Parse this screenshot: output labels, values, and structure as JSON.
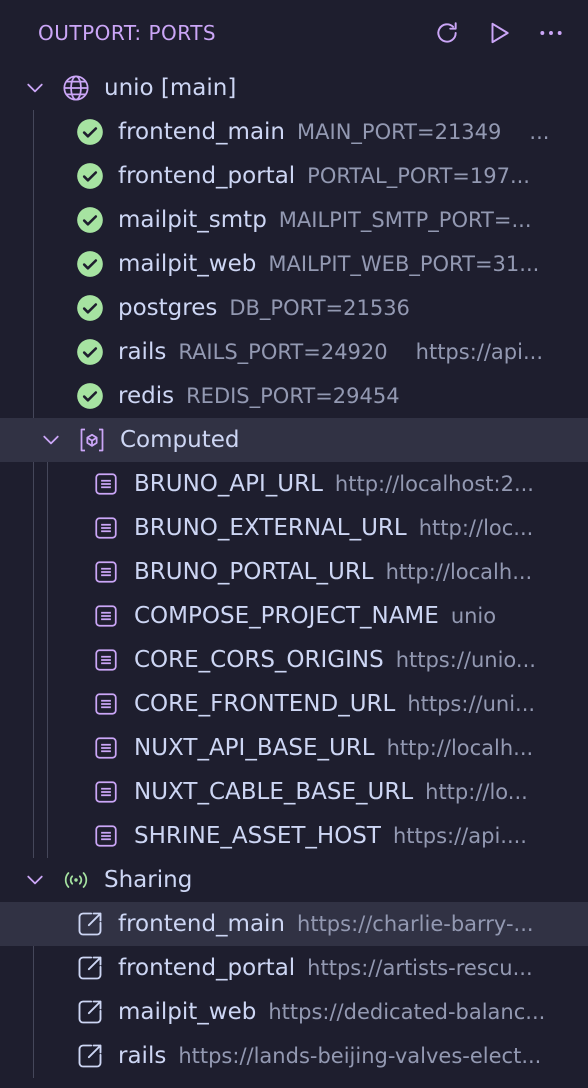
{
  "header": {
    "title": "OUTPORT: PORTS"
  },
  "project": {
    "label": "unio [main]",
    "services": [
      {
        "name": "frontend_main",
        "value": "MAIN_PORT=21349",
        "extra": "..."
      },
      {
        "name": "frontend_portal",
        "value": "PORTAL_PORT=197...",
        "extra": ""
      },
      {
        "name": "mailpit_smtp",
        "value": "MAILPIT_SMTP_PORT=...",
        "extra": ""
      },
      {
        "name": "mailpit_web",
        "value": "MAILPIT_WEB_PORT=31...",
        "extra": ""
      },
      {
        "name": "postgres",
        "value": "DB_PORT=21536",
        "extra": ""
      },
      {
        "name": "rails",
        "value": "RAILS_PORT=24920",
        "extra": "https://api..."
      },
      {
        "name": "redis",
        "value": "REDIS_PORT=29454",
        "extra": ""
      }
    ]
  },
  "computed": {
    "label": "Computed",
    "items": [
      {
        "name": "BRUNO_API_URL",
        "value": "http://localhost:2..."
      },
      {
        "name": "BRUNO_EXTERNAL_URL",
        "value": "http://loc..."
      },
      {
        "name": "BRUNO_PORTAL_URL",
        "value": "http://localh..."
      },
      {
        "name": "COMPOSE_PROJECT_NAME",
        "value": "unio"
      },
      {
        "name": "CORE_CORS_ORIGINS",
        "value": "https://unio..."
      },
      {
        "name": "CORE_FRONTEND_URL",
        "value": "https://uni..."
      },
      {
        "name": "NUXT_API_BASE_URL",
        "value": "http://localh..."
      },
      {
        "name": "NUXT_CABLE_BASE_URL",
        "value": "http://lo..."
      },
      {
        "name": "SHRINE_ASSET_HOST",
        "value": "https://api...."
      }
    ]
  },
  "sharing": {
    "label": "Sharing",
    "items": [
      {
        "name": "frontend_main",
        "value": "https://charlie-barry-..."
      },
      {
        "name": "frontend_portal",
        "value": "https://artists-rescu..."
      },
      {
        "name": "mailpit_web",
        "value": "https://dedicated-balanc..."
      },
      {
        "name": "rails",
        "value": "https://lands-beijing-valves-elect..."
      }
    ]
  },
  "colors": {
    "background": "#1e1e2e",
    "accent": "#cba6f7",
    "success": "#a6e3a1",
    "text": "#cdd6f4",
    "muted": "#9399b2",
    "highlight": "#313244"
  }
}
